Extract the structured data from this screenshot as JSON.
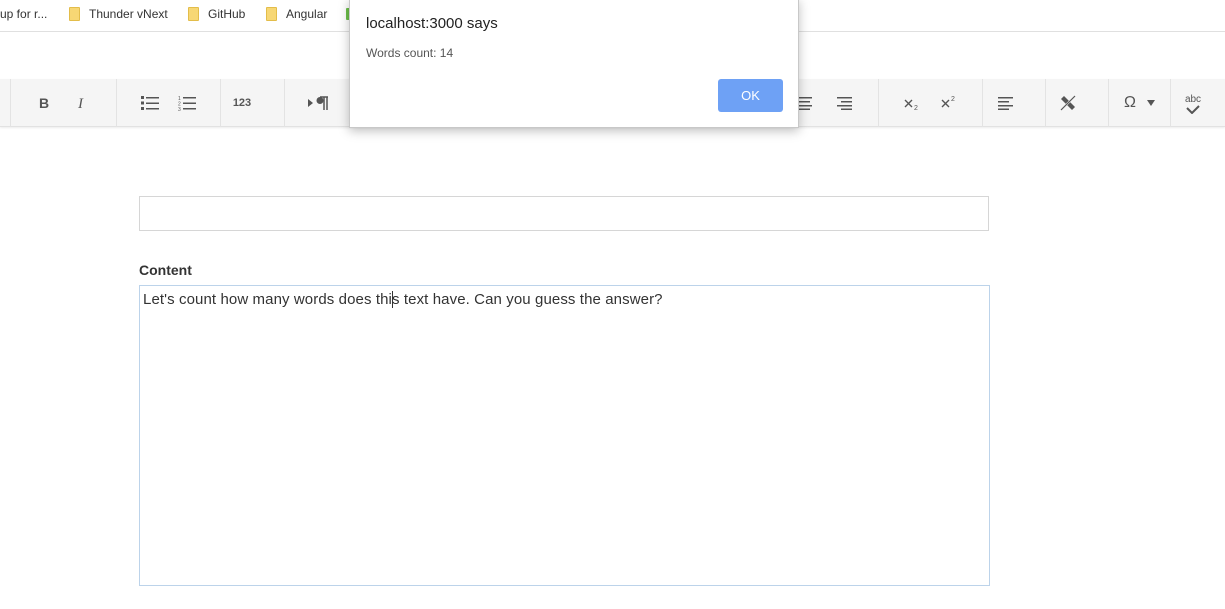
{
  "bookmarks": [
    {
      "label": "up for r..."
    },
    {
      "label": "Thunder vNext"
    },
    {
      "label": "GitHub"
    },
    {
      "label": "Angular"
    }
  ],
  "toolbar": {
    "number_format_label": "123",
    "spellcheck_label": "abc"
  },
  "form": {
    "title_value": "",
    "content_label": "Content",
    "content_before_caret": "Let's count how many words does thi",
    "content_after_caret": "s text have. Can you guess the answer?"
  },
  "dialog": {
    "title": "localhost:3000 says",
    "message": "Words count: 14",
    "ok_label": "OK"
  },
  "colors": {
    "ok_button": "#6ea1f5",
    "editor_border": "#bcd3ea",
    "folder": "#f7d774"
  }
}
